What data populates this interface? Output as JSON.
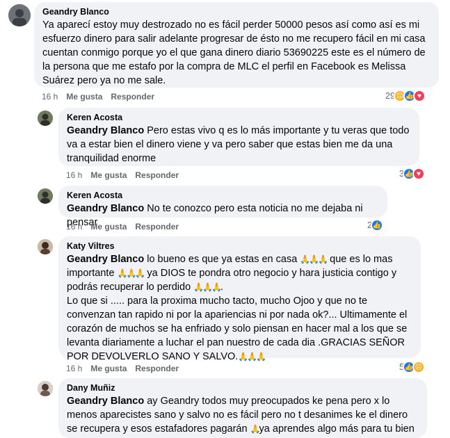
{
  "comments": [
    {
      "author": "Geandry Blanco",
      "text": "Ya aparecí estoy muy destrozado no es fácil perder 50000 pesos así como así es mi esfuerzo dinero para salir adelante progresar de ésto no me recupero fácil en mi casa cuentan conmigo porque yo el que gana dinero diario 53690225 este es el número de la persona que me estafo por la compra de MLC el perfil en Facebook es Melissa Suárez pero ya no me sale.",
      "time": "16 h",
      "like": "Me gusta",
      "reply": "Responder",
      "reaction_count": "29",
      "reaction_icons": [
        "sad-icon",
        "like-icon",
        "love-icon"
      ]
    },
    {
      "author": "Keren Acosta",
      "mention": "Geandry Blanco",
      "text": "Pero estas vivo q es lo más importante y tu veras que todo va a estar bien el dinero viene y va pero saber que estas bien me da una tranquilidad enorme",
      "time": "16 h",
      "like": "Me gusta",
      "reply": "Responder",
      "reaction_count": "3",
      "reaction_icons": [
        "like-icon",
        "love-icon"
      ]
    },
    {
      "author": "Keren Acosta",
      "mention": "Geandry Blanco",
      "text": "No te conozco pero esta noticia no me dejaba ni pensar",
      "time": "16 h",
      "like": "Me gusta",
      "reply": "Responder",
      "reaction_count": "2",
      "reaction_icons": [
        "like-icon"
      ]
    },
    {
      "author": "Katy Viltres",
      "mention": "Geandry Blanco",
      "text_parts": [
        "lo bueno es que ya estas en casa ",
        " que es lo mas importante ",
        " ya DIOS te pondra otro negocio y hara justicia contigo y podrás recuperar lo perdido ",
        ".",
        "Lo que si ..... para la proxima mucho tacto, mucho Ojoo y que no te convenzan tan rapido ni por la apariencias ni por nada ok?... Ultimamente el corazón de muchos se ha enfriado y solo piensan en hacer mal a los que se levanta diariamente a luchar el pan nuestro de cada dia .GRACIAS SEÑOR POR DEVOLVERLO SANO Y SALVO."
      ],
      "emoji": "🙏🙏🙏",
      "time": "16 h",
      "like": "Me gusta",
      "reply": "Responder",
      "reaction_count": "5",
      "reaction_icons": [
        "like-icon",
        "sad-icon"
      ]
    },
    {
      "author": "Dany Muñiz",
      "mention": "Geandry Blanco",
      "text_parts": [
        "ay Geandry todos muy preocupados ke pena pero x lo menos aparecistes sano y salvo no es fácil pero no t desanimes ke el dinero se recupera y esos estafadores pagarán ",
        "ya aprendes algo más para tu bien"
      ],
      "emoji": "🙏"
    }
  ]
}
